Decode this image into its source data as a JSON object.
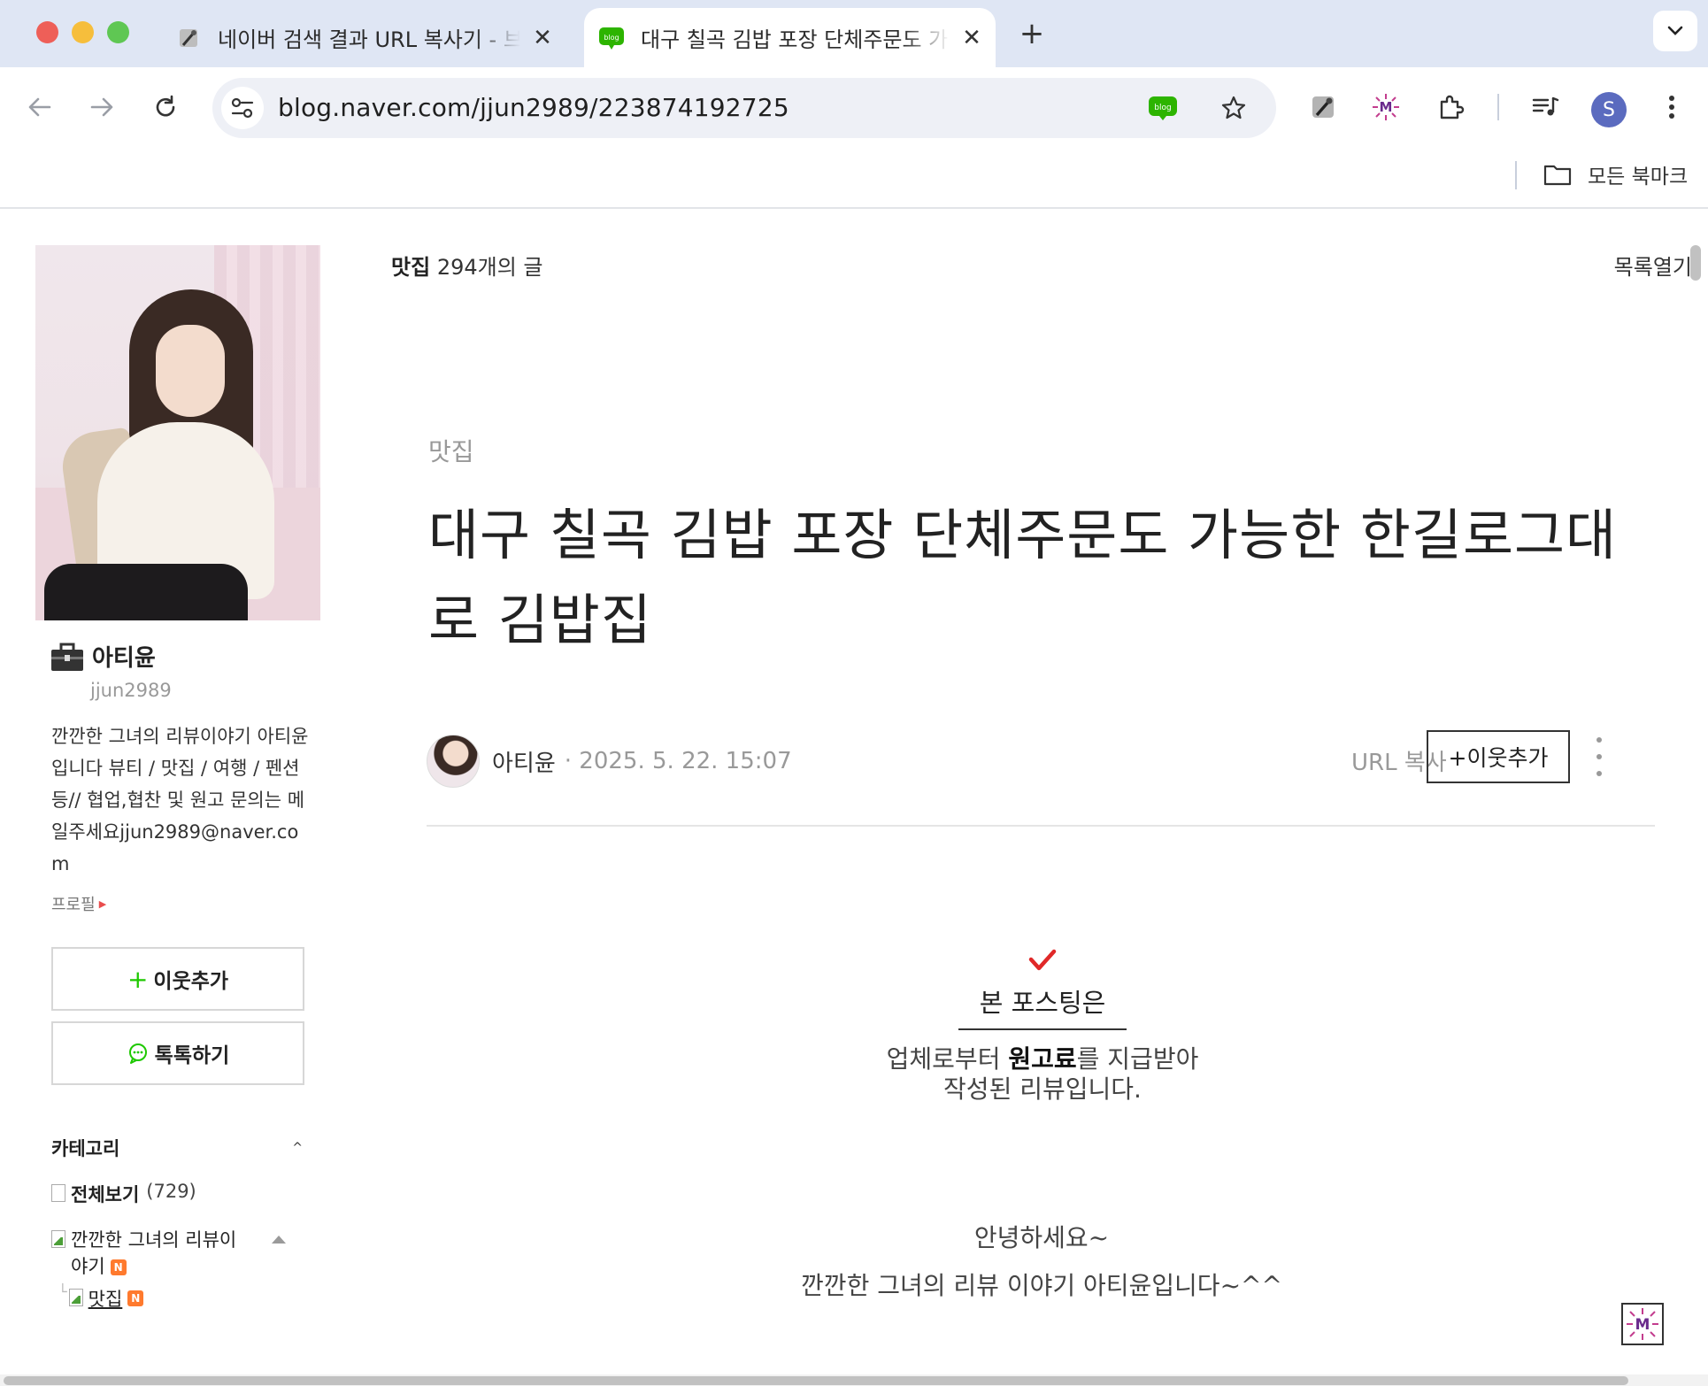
{
  "browser": {
    "tabs": [
      {
        "title": "네이버 검색 결과 URL 복사기 - 브라우저",
        "active": false
      },
      {
        "title": "대구 칠곡 김밥 포장 단체주문도 가능한",
        "active": true
      }
    ],
    "url": "blog.naver.com/jjun2989/223874192725",
    "bookmarks_all": "모든 북마크",
    "profile_initial": "S",
    "accent_color": "#1ec800"
  },
  "sidebar": {
    "nickname": "아티윤",
    "blog_id": "jjun2989",
    "intro": "깐깐한 그녀의 리뷰이야기 아티윤입니다 뷰티 / 맛집 / 여행 / 펜션 등// 협업,협찬 및 원고 문의는 메일주세요jjun2989@naver.com",
    "profile_link": "프로필",
    "follow_button": "이웃추가",
    "talk_button": "톡톡하기",
    "category_label": "카테고리",
    "categories": [
      {
        "name": "전체보기",
        "count": "(729)"
      },
      {
        "name": "깐깐한 그녀의 리뷰이야기",
        "badge": "N"
      },
      {
        "name": "맛집",
        "badge": "N"
      }
    ]
  },
  "post_list": {
    "category": "맛집",
    "count_text": "294개의 글",
    "open_list": "목록열기"
  },
  "post": {
    "category_tag": "맛집",
    "title": "대구 칠곡 김밥 포장 단체주문도 가능한 한길로그대로 김밥집",
    "author": "아티윤",
    "date": "· 2025. 5. 22. 15:07",
    "url_copy": "URL 복사",
    "follow_button": "+이웃추가",
    "disclaimer": {
      "title": "본 포스팅은",
      "line1_pre": "업체로부터 ",
      "line1_bold": "원고료",
      "line1_post": "를 지급받아",
      "line2": "작성된 리뷰입니다."
    },
    "greeting": {
      "line1": "안녕하세요~",
      "line2": "깐깐한 그녀의 리뷰 이야기 아티윤입니다~^^"
    }
  }
}
